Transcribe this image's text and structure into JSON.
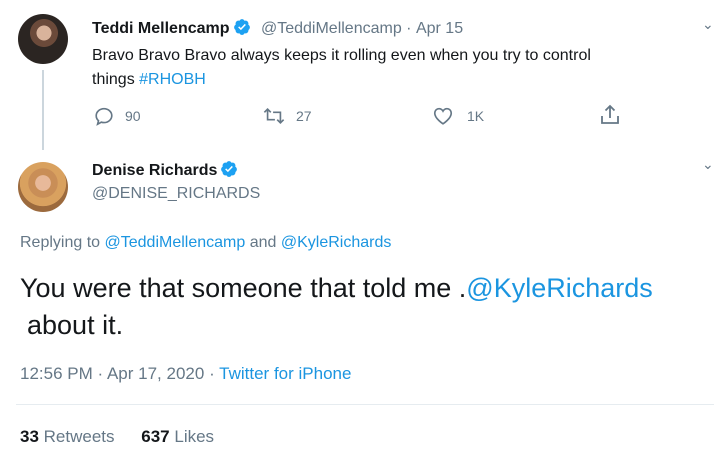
{
  "parent_tweet": {
    "author_name": "Teddi Mellencamp",
    "author_handle": "@TeddiMellencamp",
    "separator": "·",
    "date": "Apr 15",
    "text_line1": "Bravo Bravo Bravo always keeps it rolling even when you try to control",
    "text_line2_prefix": "things ",
    "hashtag": "#RHOBH",
    "replies": "90",
    "retweets": "27",
    "likes": "1K"
  },
  "main_tweet": {
    "author_name": "Denise Richards",
    "author_handle": "@DENISE_RICHARDS",
    "replying_to_label": "Replying to",
    "reply_mention_1": "@TeddiMellencamp",
    "reply_and": "and",
    "reply_mention_2": "@KyleRichards",
    "text_prefix": "You were that someone that told me .",
    "text_mention": "@KyleRichards",
    "text_suffix": "about it.",
    "time": "12:56 PM",
    "meta_separator": "·",
    "date": "Apr 17, 2020",
    "source": "Twitter for iPhone",
    "retweet_count": "33",
    "retweet_label": "Retweets",
    "like_count": "637",
    "like_label": "Likes"
  },
  "colors": {
    "link": "#1b95e0",
    "muted": "#657786",
    "verified": "#1da1f2",
    "divider": "#e6ecf0"
  },
  "icons": {
    "reply": "reply-icon",
    "retweet": "retweet-icon",
    "like": "heart-icon",
    "share": "share-icon",
    "verified": "verified-badge-icon",
    "caret": "caret-down-icon"
  }
}
